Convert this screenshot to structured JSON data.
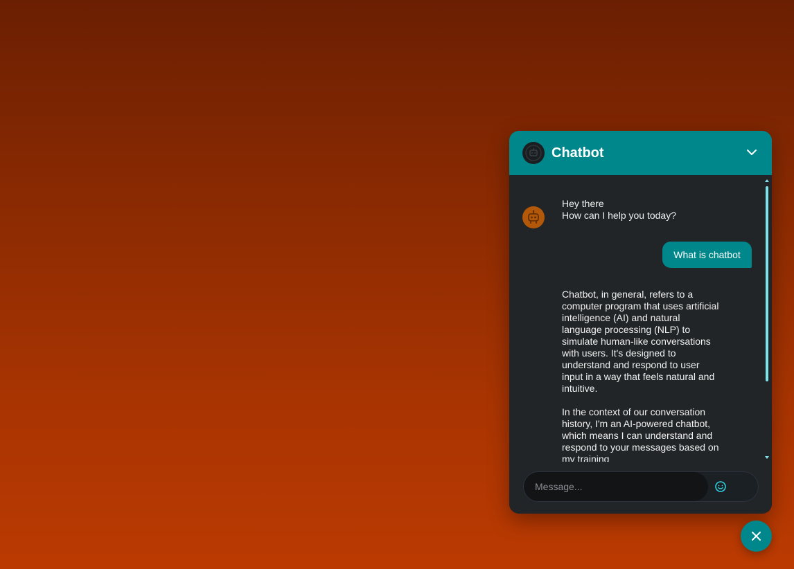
{
  "chat": {
    "title": "Chatbot",
    "messages": [
      {
        "role": "bot",
        "text": "Hey there\nHow can I help you today?"
      },
      {
        "role": "user",
        "text": "What is chatbot"
      },
      {
        "role": "bot",
        "text": "Chatbot, in general, refers to a computer program that uses artificial intelligence (AI) and natural language processing (NLP) to simulate human-like conversations with users. It's designed to understand and respond to user input in a way that feels natural and intuitive.\n\nIn the context of our conversation history, I'm an AI-powered chatbot, which means I can understand and respond to your messages based on my training"
      }
    ],
    "input_placeholder": "Message...",
    "icons": {
      "header_avatar": "robot-icon",
      "collapse": "chevron-down-icon",
      "bot_avatar": "robot-icon",
      "emoji": "smiley-icon",
      "close": "close-icon"
    }
  },
  "colors": {
    "accent": "#00878b",
    "panel": "#212528",
    "bot_avatar": "#b25808",
    "scrollbar": "#7fe3ec"
  }
}
